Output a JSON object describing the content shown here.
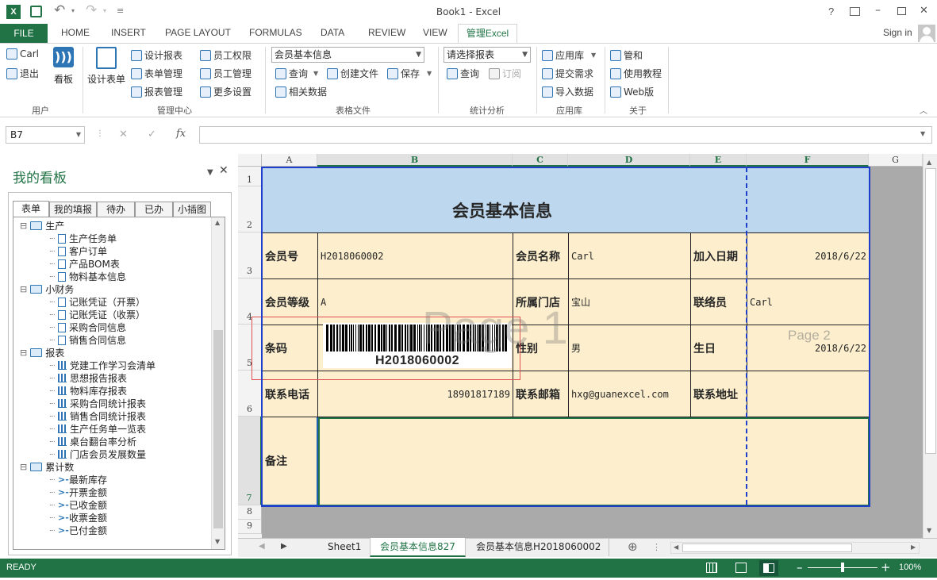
{
  "window": {
    "title": "Book1 - Excel",
    "help": "?",
    "minimize": "–",
    "restore": "❒",
    "close": "✕"
  },
  "qat": {
    "undo": "↶",
    "redo": "↷",
    "more": "≡"
  },
  "tabs": {
    "file": "FILE",
    "items": [
      "HOME",
      "INSERT",
      "PAGE LAYOUT",
      "FORMULAS",
      "DATA",
      "REVIEW",
      "VIEW"
    ],
    "active": "管理Excel",
    "signin": "Sign in"
  },
  "ribbon": {
    "user": {
      "carl": "Carl",
      "logout": "退出",
      "board": "看板",
      "label": "用户"
    },
    "mgmt": {
      "design_form": "设计表单",
      "design_report": "设计报表",
      "form_mgmt": "表单管理",
      "report_mgmt": "报表管理",
      "emp_perm": "员工权限",
      "emp_mgmt": "员工管理",
      "more": "更多设置",
      "label": "管理中心"
    },
    "files": {
      "combo": "会员基本信息",
      "query": "查询",
      "create": "创建文件",
      "save": "保存",
      "related": "相关数据",
      "label": "表格文件"
    },
    "stats": {
      "combo": "请选择报表",
      "query": "查询",
      "subscribe": "订阅",
      "label": "统计分析"
    },
    "apps": {
      "lib": "应用库",
      "submit": "提交需求",
      "import": "导入数据",
      "label": "应用库"
    },
    "about": {
      "guanhe": "管和",
      "tutorial": "使用教程",
      "web": "Web版",
      "label": "关于"
    }
  },
  "formula": {
    "namebox": "B7",
    "cancel": "✕",
    "enter": "✓",
    "fx": "fx",
    "value": ""
  },
  "pane": {
    "title": "我的看板",
    "tabs": [
      "表单",
      "我的填报",
      "待办",
      "已办",
      "小插图"
    ],
    "tree": [
      {
        "type": "folder",
        "label": "生产"
      },
      {
        "type": "doc",
        "label": "生产任务单"
      },
      {
        "type": "doc",
        "label": "客户订单"
      },
      {
        "type": "doc",
        "label": "产品BOM表"
      },
      {
        "type": "doc",
        "label": "物料基本信息"
      },
      {
        "type": "folder",
        "label": "小财务"
      },
      {
        "type": "doc",
        "label": "记账凭证（开票）"
      },
      {
        "type": "doc",
        "label": "记账凭证（收票）"
      },
      {
        "type": "doc",
        "label": "采购合同信息"
      },
      {
        "type": "doc",
        "label": "销售合同信息"
      },
      {
        "type": "folder",
        "label": "报表"
      },
      {
        "type": "bar",
        "label": "党建工作学习会清单"
      },
      {
        "type": "bar",
        "label": "思想报告报表"
      },
      {
        "type": "bar",
        "label": "物料库存报表"
      },
      {
        "type": "bar",
        "label": "采购合同统计报表"
      },
      {
        "type": "bar",
        "label": "销售合同统计报表"
      },
      {
        "type": "bar",
        "label": "生产任务单一览表"
      },
      {
        "type": "bar",
        "label": "桌台翻台率分析"
      },
      {
        "type": "bar",
        "label": "门店会员发展数量"
      },
      {
        "type": "folder",
        "label": "累计数"
      },
      {
        "type": "sum",
        "label": "最新库存"
      },
      {
        "type": "sum",
        "label": "开票金额"
      },
      {
        "type": "sum",
        "label": "已收金额"
      },
      {
        "type": "sum",
        "label": "收票金额"
      },
      {
        "type": "sum",
        "label": "已付金额"
      }
    ]
  },
  "sheet": {
    "cols": [
      "A",
      "B",
      "C",
      "D",
      "E",
      "F",
      "G"
    ],
    "rows": [
      "1",
      "2",
      "3",
      "4",
      "5",
      "6",
      "7",
      "8",
      "9"
    ],
    "title": "会员基本信息",
    "watermark1": "Page 1",
    "watermark2": "Page 2",
    "r3": {
      "a": "会员号",
      "b": "H2018060002",
      "c": "会员名称",
      "d": "Carl",
      "e": "加入日期",
      "f": "2018/6/22"
    },
    "r4": {
      "a": "会员等级",
      "b": "A",
      "c": "所属门店",
      "d": "宝山",
      "e": "联络员",
      "f": "Carl"
    },
    "r5": {
      "a": "条码",
      "barcode": "H2018060002",
      "c": "性别",
      "d": "男",
      "e": "生日",
      "f": "2018/6/22"
    },
    "r6": {
      "a": "联系电话",
      "b": "18901817189",
      "c": "联系邮箱",
      "d": "hxg@guanexcel.com",
      "e": "联系地址",
      "f": ""
    },
    "r7": {
      "a": "备注"
    }
  },
  "sheettabs": {
    "items": [
      "Sheet1",
      "会员基本信息827",
      "会员基本信息H2018060002"
    ],
    "active": 1,
    "add": "⊕"
  },
  "status": {
    "ready": "READY",
    "zoom": "100%",
    "minus": "–",
    "plus": "+",
    "zoom_level": 0.5
  }
}
